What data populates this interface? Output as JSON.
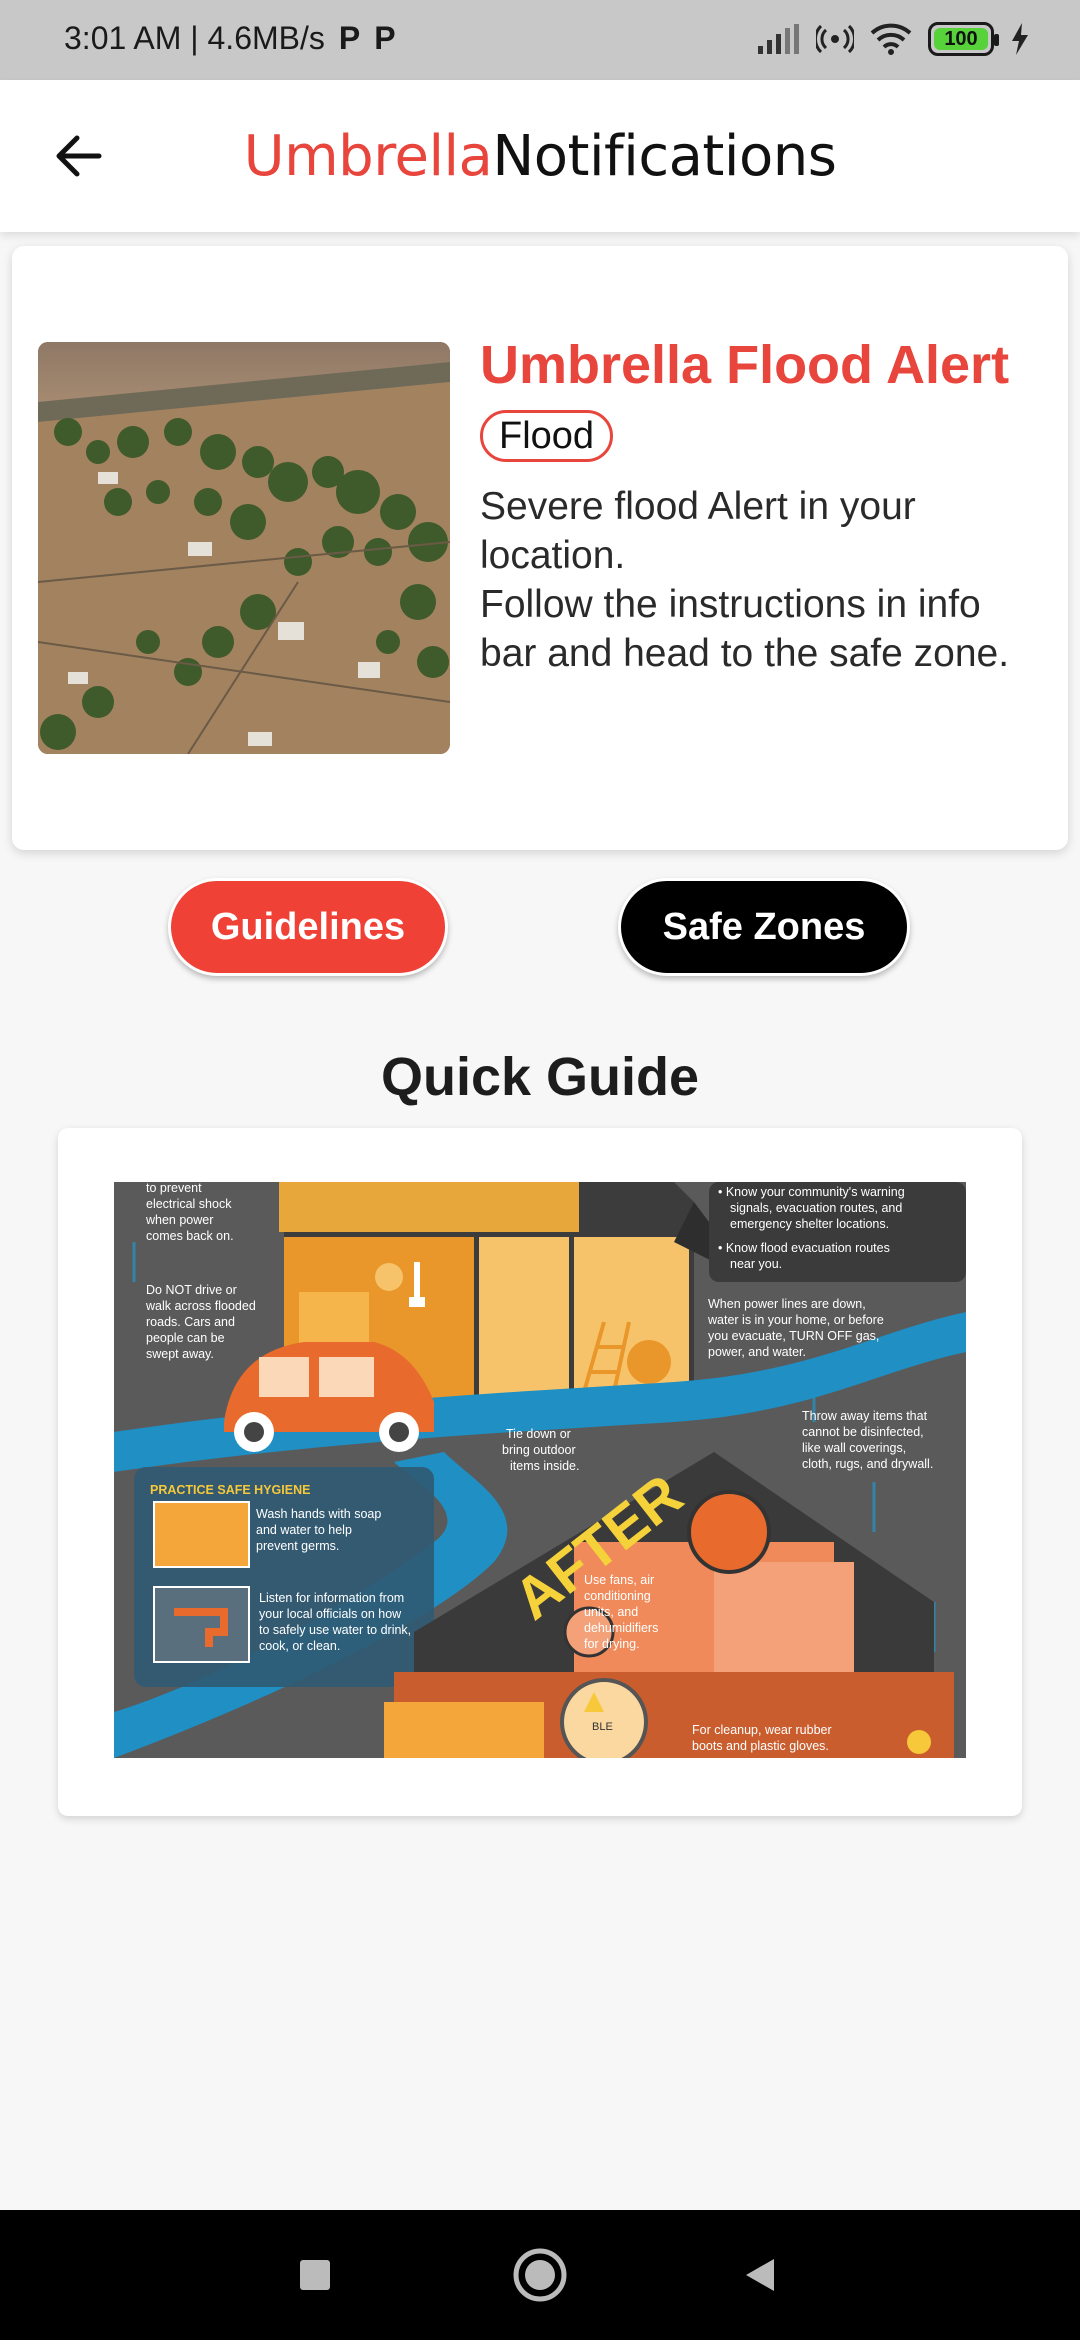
{
  "status_bar": {
    "time_speed": "3:01 AM | 4.6MB/s",
    "battery": "100",
    "icons": [
      "p-icon",
      "p-icon",
      "signal-icon",
      "hotspot-icon",
      "wifi-icon",
      "battery-icon",
      "charging-icon"
    ]
  },
  "app_bar": {
    "brand": "Umbrella",
    "title": "Notifications",
    "back_icon": "arrow-left-icon"
  },
  "alert": {
    "title": "Umbrella Flood Alert",
    "tag": "Flood",
    "description": "Severe flood Alert in your location.\nFollow the instructions in info bar and head to the safe zone."
  },
  "buttons": {
    "guidelines": "Guidelines",
    "safe_zones": "Safe Zones"
  },
  "quick_guide": {
    "title": "Quick Guide",
    "infographic": {
      "t1": "to prevent",
      "t2": "electrical shock",
      "t3": "when power",
      "t4": "comes back on.",
      "d1": "Do NOT drive or",
      "d2": "walk across flooded",
      "d3": "roads. Cars and",
      "d4": "people can be",
      "d5": "swept away.",
      "k1": "• Know your community's warning",
      "k2": "signals, evacuation routes, and",
      "k3": "emergency shelter locations.",
      "k4": "• Know flood evacuation routes",
      "k5": "near you.",
      "w1": "When power lines are down,",
      "w2": "water is in your home, or before",
      "w3": "you evacuate, TURN OFF gas,",
      "w4": "power, and water.",
      "tie1": "Tie down or",
      "tie2": "bring outdoor",
      "tie3": "items inside.",
      "th1": "Throw away items that",
      "th2": "cannot be disinfected,",
      "th3": "like wall coverings,",
      "th4": "cloth, rugs, and drywall.",
      "hyg": "PRACTICE SAFE HYGIENE",
      "h1": "Wash hands with soap",
      "h2": "and water to help",
      "h3": "prevent germs.",
      "l1": "Listen for information from",
      "l2": "your local officials on how",
      "l3": "to safely use water to drink,",
      "l4": "cook, or clean.",
      "after": "AFTER",
      "f1": "Use fans, air",
      "f2": "conditioning",
      "f3": "units, and",
      "f4": "dehumidifiers",
      "f5": "for drying.",
      "c1": "For cleanup, wear rubber",
      "c2": "boots and plastic gloves.",
      "bleach": "BLE"
    }
  },
  "nav": {
    "icons": [
      "square-icon",
      "circle-home-icon",
      "triangle-back-icon"
    ]
  },
  "colors": {
    "brand_red": "#e8453c",
    "button_red": "#ef4136",
    "black": "#000000"
  }
}
